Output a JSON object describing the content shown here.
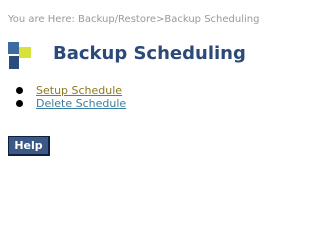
{
  "breadcrumb": "You are Here: Backup/Restore>Backup Scheduling",
  "header": {
    "logo_icon": "tiles-logo-icon",
    "title": "Backup Scheduling"
  },
  "menu": {
    "items": [
      {
        "label": "Setup Schedule",
        "color": "#8c7a1e"
      },
      {
        "label": "Delete Schedule",
        "color": "#3a7fa0"
      }
    ]
  },
  "help_button": {
    "label": "Help"
  },
  "colors": {
    "title": "#2b4a7a",
    "button_bg": "#3b5887",
    "breadcrumb": "#999999"
  }
}
